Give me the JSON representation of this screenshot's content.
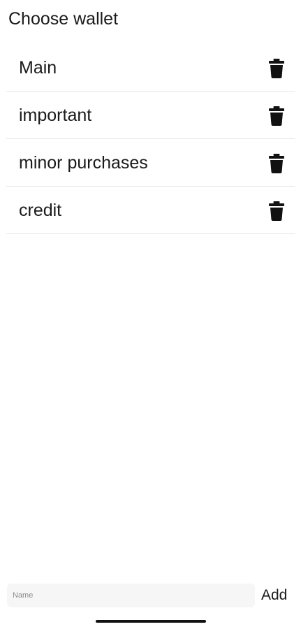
{
  "page": {
    "title": "Choose wallet"
  },
  "wallets": [
    {
      "name": "Main",
      "delete_icon": "trash-icon"
    },
    {
      "name": "important",
      "delete_icon": "trash-icon"
    },
    {
      "name": "minor purchases",
      "delete_icon": "trash-icon"
    },
    {
      "name": "credit",
      "delete_icon": "trash-icon"
    }
  ],
  "add_bar": {
    "input_value": "",
    "input_placeholder": "Name",
    "add_label": "Add"
  },
  "colors": {
    "text": "#1a1a1a",
    "divider": "#e6e6e6",
    "input_background": "#f6f6f6",
    "icon": "#111111"
  }
}
